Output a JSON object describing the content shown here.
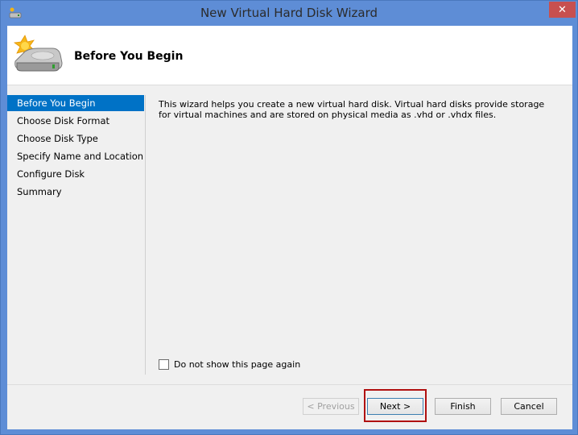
{
  "window": {
    "title": "New Virtual Hard Disk Wizard",
    "close_label": "✕"
  },
  "header": {
    "title": "Before You Begin"
  },
  "nav": {
    "items": [
      {
        "label": "Before You Begin",
        "active": true
      },
      {
        "label": "Choose Disk Format",
        "active": false
      },
      {
        "label": "Choose Disk Type",
        "active": false
      },
      {
        "label": "Specify Name and Location",
        "active": false
      },
      {
        "label": "Configure Disk",
        "active": false
      },
      {
        "label": "Summary",
        "active": false
      }
    ]
  },
  "content": {
    "description": "This wizard helps you create a new virtual hard disk. Virtual hard disks provide storage for virtual machines and are stored on physical media as .vhd or .vhdx files."
  },
  "checkbox": {
    "label": "Do not show this page again",
    "checked": false
  },
  "buttons": {
    "previous": "< Previous",
    "next": "Next >",
    "finish": "Finish",
    "cancel": "Cancel"
  },
  "colors": {
    "title_bar": "#5e8dd6",
    "close_button": "#c75050",
    "nav_selected": "#0072c6",
    "highlight": "#b01010"
  }
}
